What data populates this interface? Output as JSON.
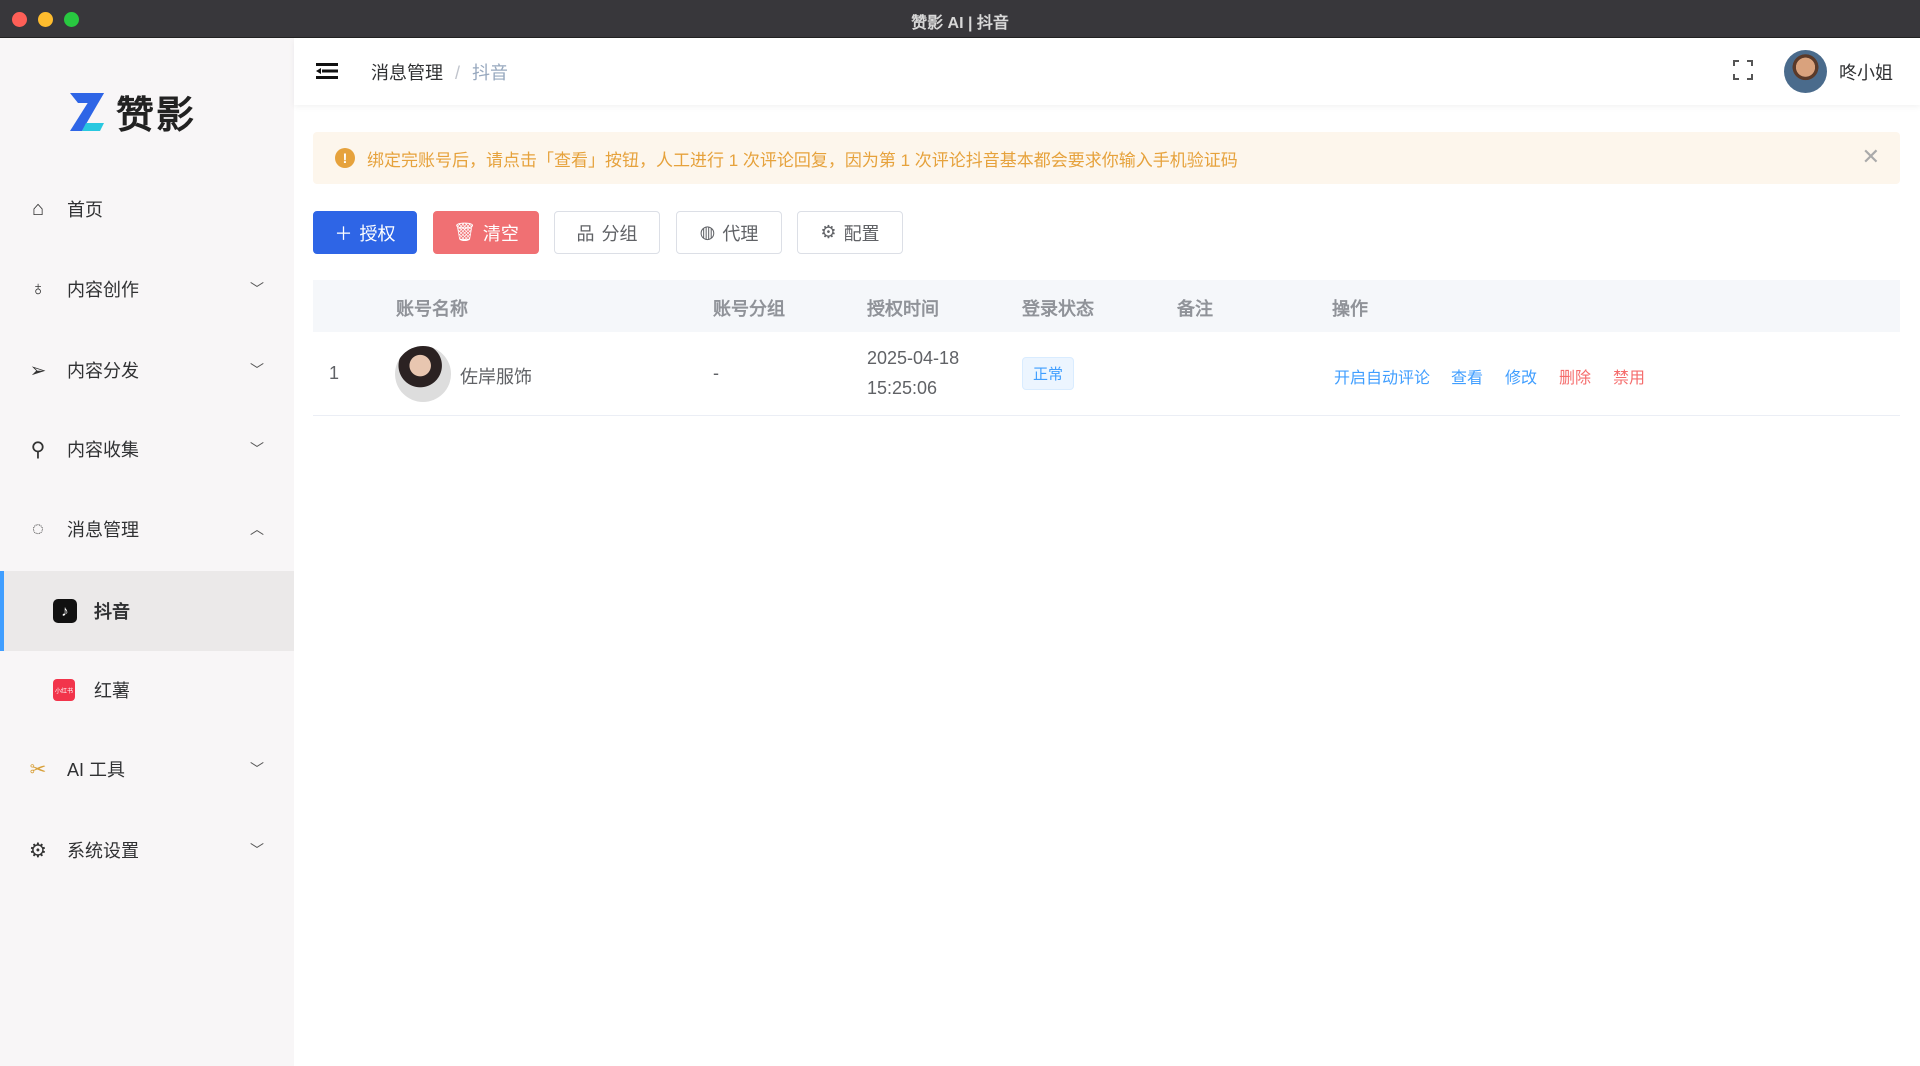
{
  "window": {
    "title": "赞影 AI | 抖音"
  },
  "logo": {
    "text": "赞影"
  },
  "sidebar": {
    "items": [
      {
        "label": "首页",
        "icon": "home-icon"
      },
      {
        "label": "内容创作",
        "icon": "bulb-icon"
      },
      {
        "label": "内容分发",
        "icon": "send-icon"
      },
      {
        "label": "内容收集",
        "icon": "search-list-icon"
      },
      {
        "label": "消息管理",
        "icon": "chat-icon"
      },
      {
        "label": "抖音",
        "icon": "douyin-icon"
      },
      {
        "label": "红薯",
        "icon": "xiaohongshu-icon"
      },
      {
        "label": "AI 工具",
        "icon": "tools-icon"
      },
      {
        "label": "系统设置",
        "icon": "gear-icon"
      }
    ]
  },
  "header": {
    "breadcrumb": [
      "消息管理",
      "抖音"
    ],
    "separator": "/",
    "username": "咚小姐"
  },
  "alert": {
    "text": "绑定完账号后，请点击「查看」按钮，人工进行 1 次评论回复，因为第 1 次评论抖音基本都会要求你输入手机验证码"
  },
  "toolbar": {
    "authorize": "授权",
    "clear": "清空",
    "group": "分组",
    "proxy": "代理",
    "config": "配置"
  },
  "table": {
    "headers": [
      "账号名称",
      "账号分组",
      "授权时间",
      "登录状态",
      "备注",
      "操作"
    ],
    "rows": [
      {
        "index": "1",
        "name": "佐岸服饰",
        "group": "-",
        "date": "2025-04-18",
        "time": "15:25:06",
        "status": "正常",
        "note": "",
        "actions": [
          "开启自动评论",
          "查看",
          "修改",
          "删除",
          "禁用"
        ]
      }
    ]
  },
  "colors": {
    "primary": "#2e65e6",
    "danger": "#f07073",
    "link": "#409eff",
    "link_danger": "#f56c6c"
  }
}
